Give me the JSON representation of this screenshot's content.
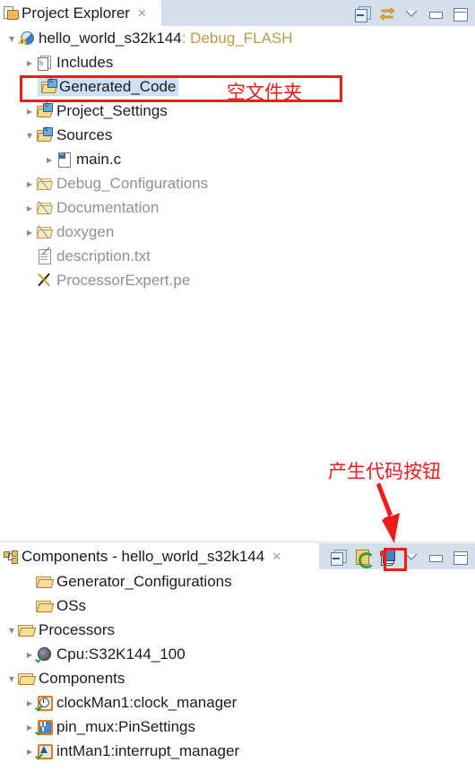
{
  "project_explorer": {
    "tab": {
      "title": "Project Explorer",
      "close_label": "✕",
      "icon": "project-explorer-icon"
    },
    "toolbar": [
      {
        "name": "collapse-all-button",
        "tooltip": "Collapse All"
      },
      {
        "name": "link-with-editor-button",
        "tooltip": "Link with Editor"
      },
      {
        "name": "view-menu-button",
        "tooltip": "View Menu"
      },
      {
        "name": "minimize-button",
        "tooltip": "Minimize"
      },
      {
        "name": "maximize-button",
        "tooltip": "Maximize"
      }
    ],
    "tree": [
      {
        "label": "hello_world_s32k144",
        "suffix": ": Debug_FLASH",
        "icon": "project-icon",
        "twisty": "expanded",
        "indent": 0,
        "dim": false,
        "selected": false
      },
      {
        "label": "Includes",
        "suffix": "",
        "icon": "includes-icon",
        "twisty": "collapsed",
        "indent": 1,
        "dim": false,
        "selected": false
      },
      {
        "label": "Generated_Code",
        "suffix": "",
        "icon": "source-folder-icon",
        "twisty": "none",
        "indent": 1,
        "dim": false,
        "selected": true
      },
      {
        "label": "Project_Settings",
        "suffix": "",
        "icon": "source-folder-icon",
        "twisty": "collapsed",
        "indent": 1,
        "dim": false,
        "selected": false
      },
      {
        "label": "Sources",
        "suffix": "",
        "icon": "source-folder-icon",
        "twisty": "expanded",
        "indent": 1,
        "dim": false,
        "selected": false
      },
      {
        "label": "main.c",
        "suffix": "",
        "icon": "c-file-icon",
        "twisty": "collapsed",
        "indent": 2,
        "dim": false,
        "selected": false
      },
      {
        "label": "Debug_Configurations",
        "suffix": "",
        "icon": "excluded-folder-icon",
        "twisty": "collapsed",
        "indent": 1,
        "dim": true,
        "selected": false
      },
      {
        "label": "Documentation",
        "suffix": "",
        "icon": "excluded-folder-icon",
        "twisty": "collapsed",
        "indent": 1,
        "dim": true,
        "selected": false
      },
      {
        "label": "doxygen",
        "suffix": "",
        "icon": "excluded-folder-icon",
        "twisty": "collapsed",
        "indent": 1,
        "dim": true,
        "selected": false
      },
      {
        "label": "description.txt",
        "suffix": "",
        "icon": "text-file-icon",
        "twisty": "none",
        "indent": 1,
        "dim": true,
        "selected": false
      },
      {
        "label": "ProcessorExpert.pe",
        "suffix": "",
        "icon": "processor-expert-file-icon",
        "twisty": "none",
        "indent": 1,
        "dim": true,
        "selected": false
      }
    ]
  },
  "components_view": {
    "tab": {
      "title": "Components - hello_world_s32k144",
      "close_label": "✕",
      "icon": "components-icon"
    },
    "toolbar": [
      {
        "name": "collapse-all-button",
        "tooltip": "Collapse All"
      },
      {
        "name": "refresh-button",
        "tooltip": "Refresh"
      },
      {
        "name": "generate-code-button",
        "tooltip": "Generate Processor Expert Code"
      },
      {
        "name": "view-menu-button",
        "tooltip": "View Menu"
      },
      {
        "name": "minimize-button",
        "tooltip": "Minimize"
      },
      {
        "name": "maximize-button",
        "tooltip": "Maximize"
      }
    ],
    "tree": [
      {
        "label": "Generator_Configurations",
        "icon": "folder-icon",
        "twisty": "none",
        "indent": 1
      },
      {
        "label": "OSs",
        "icon": "folder-icon",
        "twisty": "none",
        "indent": 1
      },
      {
        "label": "Processors",
        "icon": "folder-icon",
        "twisty": "expanded",
        "indent": 0
      },
      {
        "label": "Cpu:S32K144_100",
        "icon": "cpu-icon",
        "twisty": "collapsed",
        "indent": 1
      },
      {
        "label": "Components",
        "icon": "folder-icon",
        "twisty": "expanded",
        "indent": 0
      },
      {
        "label": "clockMan1:clock_manager",
        "icon": "clock-component-icon",
        "twisty": "collapsed",
        "indent": 1
      },
      {
        "label": "pin_mux:PinSettings",
        "icon": "pin-mux-component-icon",
        "twisty": "collapsed",
        "indent": 1
      },
      {
        "label": "intMan1:interrupt_manager",
        "icon": "interrupt-manager-component-icon",
        "twisty": "collapsed",
        "indent": 1
      }
    ]
  },
  "annotations": {
    "empty_folder_note": "空文件夹",
    "generate_code_note": "产生代码按钮",
    "color": "#ee1b1b"
  }
}
